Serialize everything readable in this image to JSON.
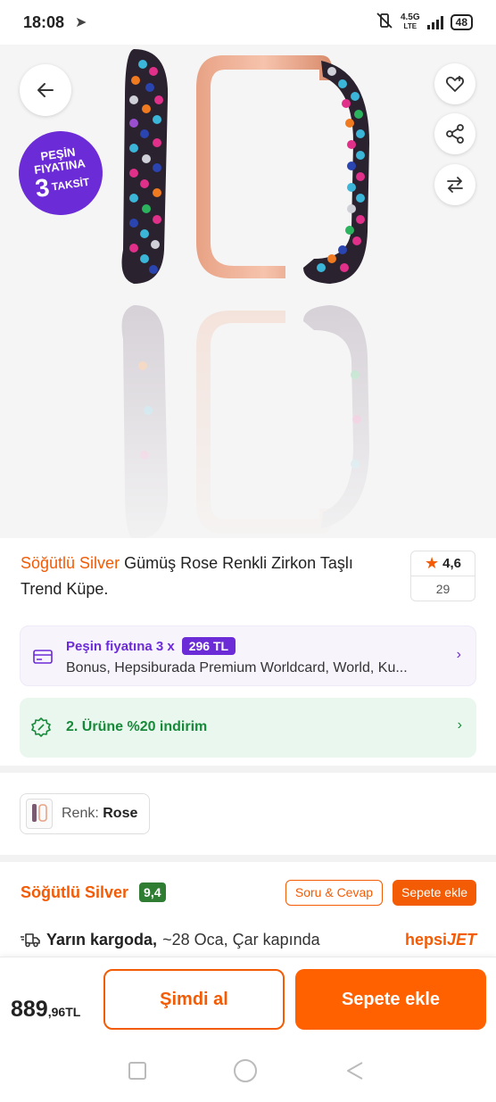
{
  "status_bar": {
    "time": "18:08",
    "network": "4.5G",
    "network_sub": "LTE",
    "battery": "48"
  },
  "hero": {
    "promo_badge": {
      "line1": "PEŞİN",
      "line2": "FIYATINA",
      "number": "3",
      "word": "TAKSİT"
    }
  },
  "product": {
    "brand": "Söğütlü Silver",
    "title": "Gümüş Rose Renkli Zirkon Taşlı Trend Küpe.",
    "rating": "4,6",
    "review_count": "29"
  },
  "installment": {
    "label": "Peşin fiyatına 3 x",
    "amount": "296 TL",
    "cards": "Bonus, Hepsiburada Premium Worldcard, World, Ku..."
  },
  "discount": {
    "text": "2. Ürüne %20 indirim"
  },
  "variant": {
    "label": "Renk:",
    "value": "Rose"
  },
  "seller": {
    "name": "Söğütlü Silver",
    "score": "9,4",
    "qa_label": "Soru & Cevap",
    "add_to_cart_label": "Sepete ekle"
  },
  "delivery": {
    "strong": "Yarın kargoda,",
    "rest": "~28 Oca, Çar kapında",
    "jet_part1": "hepsi",
    "jet_part2": "JET"
  },
  "bottom_bar": {
    "price_main": "889",
    "price_cents": ",96",
    "price_currency": "TL",
    "buy_now_label": "Şimdi al",
    "add_to_cart_label": "Sepete ekle"
  },
  "colors": {
    "brand_orange": "#f35b04",
    "cta_orange": "#ff6000",
    "purple": "#6b2bd6",
    "green": "#178a3a"
  }
}
